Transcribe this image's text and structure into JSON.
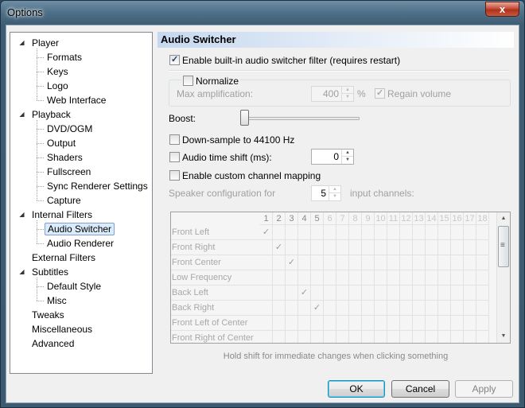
{
  "window": {
    "title": "Options",
    "close_glyph": "x"
  },
  "tree": {
    "items": [
      {
        "label": "Player",
        "level": 0,
        "expanded": true
      },
      {
        "label": "Formats",
        "level": 1
      },
      {
        "label": "Keys",
        "level": 1
      },
      {
        "label": "Logo",
        "level": 1
      },
      {
        "label": "Web Interface",
        "level": 1
      },
      {
        "label": "Playback",
        "level": 0,
        "expanded": true
      },
      {
        "label": "DVD/OGM",
        "level": 1
      },
      {
        "label": "Output",
        "level": 1
      },
      {
        "label": "Shaders",
        "level": 1
      },
      {
        "label": "Fullscreen",
        "level": 1
      },
      {
        "label": "Sync Renderer Settings",
        "level": 1
      },
      {
        "label": "Capture",
        "level": 1
      },
      {
        "label": "Internal Filters",
        "level": 0,
        "expanded": true
      },
      {
        "label": "Audio Switcher",
        "level": 1,
        "selected": true
      },
      {
        "label": "Audio Renderer",
        "level": 1
      },
      {
        "label": "External Filters",
        "level": 0
      },
      {
        "label": "Subtitles",
        "level": 0,
        "expanded": true
      },
      {
        "label": "Default Style",
        "level": 1
      },
      {
        "label": "Misc",
        "level": 1
      },
      {
        "label": "Tweaks",
        "level": 0
      },
      {
        "label": "Miscellaneous",
        "level": 0
      },
      {
        "label": "Advanced",
        "level": 0
      }
    ]
  },
  "panel": {
    "header": "Audio Switcher",
    "enable_filter": {
      "label": "Enable built-in audio switcher filter (requires restart)",
      "checked": true
    },
    "normalize": {
      "label": "Normalize",
      "checked": false
    },
    "max_amplification": {
      "label": "Max amplification:",
      "value": "400",
      "unit": "%"
    },
    "regain_volume": {
      "label": "Regain volume",
      "checked": true
    },
    "boost": {
      "label": "Boost:",
      "level": 0
    },
    "downsample": {
      "label": "Down-sample to 44100 Hz",
      "checked": false
    },
    "time_shift": {
      "label": "Audio time shift (ms):",
      "checked": false,
      "value": "0"
    },
    "custom_mapping": {
      "label": "Enable custom channel mapping",
      "checked": false
    },
    "speaker_config": {
      "prefix": "Speaker configuration for",
      "value": "5",
      "suffix": "input channels:"
    },
    "matrix": {
      "columns": [
        "1",
        "2",
        "3",
        "4",
        "5",
        "6",
        "7",
        "8",
        "9",
        "10",
        "11",
        "12",
        "13",
        "14",
        "15",
        "16",
        "17",
        "18"
      ],
      "rows": [
        {
          "label": "Front Left",
          "checked_col": 1
        },
        {
          "label": "Front Right",
          "checked_col": 2
        },
        {
          "label": "Front Center",
          "checked_col": 3
        },
        {
          "label": "Low Frequency",
          "checked_col": 0
        },
        {
          "label": "Back Left",
          "checked_col": 4
        },
        {
          "label": "Back Right",
          "checked_col": 5
        },
        {
          "label": "Front Left of Center",
          "checked_col": 0
        },
        {
          "label": "Front Right of Center",
          "checked_col": 0
        }
      ]
    },
    "hint": "Hold shift for immediate changes when clicking something"
  },
  "buttons": {
    "ok": "OK",
    "cancel": "Cancel",
    "apply": "Apply"
  },
  "colors": {
    "header_gradient_start": "#c6d8ef",
    "selection": "#dcebfc",
    "frame": "#3e5d74"
  }
}
